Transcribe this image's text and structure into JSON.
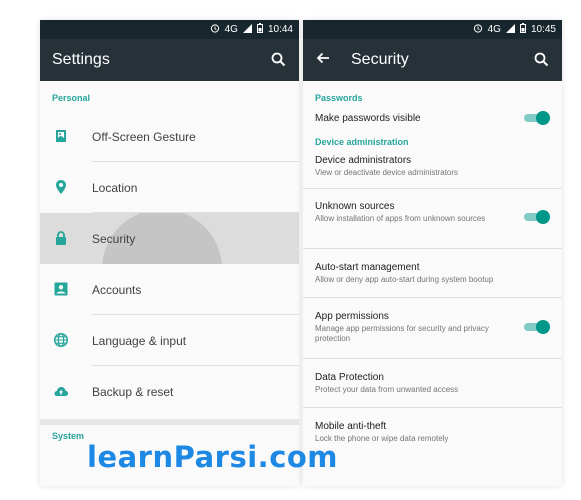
{
  "left": {
    "status": {
      "time": "10:44",
      "network": "4G"
    },
    "title": "Settings",
    "section_personal": "Personal",
    "items": [
      {
        "label": "Off-Screen Gesture",
        "icon": "image-icon"
      },
      {
        "label": "Location",
        "icon": "location-pin-icon"
      },
      {
        "label": "Security",
        "icon": "lock-icon"
      },
      {
        "label": "Accounts",
        "icon": "account-box-icon"
      },
      {
        "label": "Language & input",
        "icon": "globe-icon"
      },
      {
        "label": "Backup & reset",
        "icon": "cloud-upload-icon"
      }
    ],
    "section_system": "System"
  },
  "right": {
    "status": {
      "time": "10:45",
      "network": "4G"
    },
    "title": "Security",
    "section_passwords": "Passwords",
    "make_passwords": {
      "title": "Make passwords visible",
      "enabled": true
    },
    "section_device": "Device administration",
    "items": [
      {
        "title": "Device administrators",
        "subtitle": "View or deactivate device administrators"
      },
      {
        "title": "Unknown sources",
        "subtitle": "Allow installation of apps from unknown sources",
        "enabled": true
      },
      {
        "title": "Auto-start management",
        "subtitle": "Allow or deny app auto-start during system bootup"
      },
      {
        "title": "App permissions",
        "subtitle": "Manage app permissions for security and privacy protection",
        "enabled": true
      },
      {
        "title": "Data Protection",
        "subtitle": "Protect your data from unwanted access"
      },
      {
        "title": "Mobile anti-theft",
        "subtitle": "Lock the phone or wipe data remotely"
      }
    ]
  },
  "watermark": "learnParsi.com",
  "colors": {
    "accent": "#26a69a",
    "toolbar": "#263238",
    "statusbar": "#17272d",
    "toggle_on": "#009688",
    "watermark": "#1e88e5"
  }
}
